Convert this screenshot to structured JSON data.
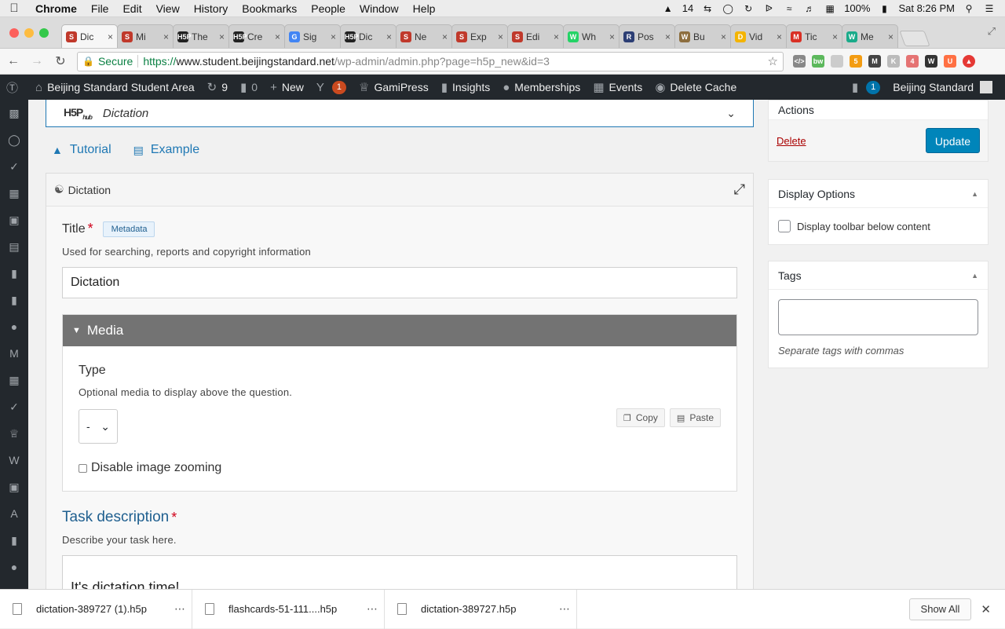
{
  "menubar": {
    "app": "Chrome",
    "items": [
      "File",
      "Edit",
      "View",
      "History",
      "Bookmarks",
      "People",
      "Window",
      "Help"
    ],
    "status": {
      "adobe_count": "14",
      "battery": "100%",
      "clock": "Sat 8:26 PM"
    }
  },
  "tabs": [
    {
      "label": "Dic",
      "favicon": "S",
      "color": "#c0392b",
      "active": true
    },
    {
      "label": "Mi",
      "favicon": "S",
      "color": "#c0392b"
    },
    {
      "label": "The",
      "favicon": "H5P",
      "color": "#222222"
    },
    {
      "label": "Cre",
      "favicon": "H5P",
      "color": "#222222"
    },
    {
      "label": "Sig",
      "favicon": "G",
      "color": "#4285f4"
    },
    {
      "label": "Dic",
      "favicon": "H5P",
      "color": "#222222"
    },
    {
      "label": "Ne",
      "favicon": "S",
      "color": "#c0392b"
    },
    {
      "label": "Exp",
      "favicon": "S",
      "color": "#c0392b"
    },
    {
      "label": "Edi",
      "favicon": "S",
      "color": "#c0392b"
    },
    {
      "label": "Wh",
      "favicon": "W",
      "color": "#25d366"
    },
    {
      "label": "Pos",
      "favicon": "R",
      "color": "#2c3e74"
    },
    {
      "label": "Bu",
      "favicon": "W",
      "color": "#8d6e3f"
    },
    {
      "label": "Vid",
      "favicon": "D",
      "color": "#f4b400"
    },
    {
      "label": "Tic",
      "favicon": "M",
      "color": "#d93025"
    },
    {
      "label": "Me",
      "favicon": "W",
      "color": "#1aab8a"
    }
  ],
  "omnibox": {
    "secure_label": "Secure",
    "scheme": "https://",
    "host": "www.student.beijingstandard.net",
    "path": "/wp-admin/admin.php?page=h5p_new&id=3"
  },
  "adminbar": {
    "site_name": "Beijing Standard Student Area",
    "updates_count": "9",
    "comments_count": "0",
    "new_label": "New",
    "yoast_count": "1",
    "gamipress": "GamiPress",
    "insights": "Insights",
    "memberships": "Memberships",
    "events": "Events",
    "delete_cache": "Delete Cache",
    "notif_count": "1",
    "user_name": "Beijing Standard"
  },
  "hub": {
    "logo": "H5P",
    "logo_sub": "hub",
    "content_type": "Dictation"
  },
  "help_links": {
    "tutorial": "Tutorial",
    "example": "Example"
  },
  "editor": {
    "header": "Dictation",
    "title_label": "Title",
    "metadata_button": "Metadata",
    "title_desc": "Used for searching, reports and copyright information",
    "title_value": "Dictation",
    "media_group": "Media",
    "type_label": "Type",
    "type_desc": "Optional media to display above the question.",
    "type_value": "-",
    "copy_label": "Copy",
    "paste_label": "Paste",
    "disable_zoom_label": "Disable image zooming",
    "task_label": "Task description",
    "task_desc": "Describe your task here.",
    "task_value": "It's dictation time!"
  },
  "sidebar": {
    "actions_title": "Actions",
    "delete_label": "Delete",
    "update_label": "Update",
    "display_options_title": "Display Options",
    "display_toolbar_label": "Display toolbar below content",
    "tags_title": "Tags",
    "tags_hint": "Separate tags with commas"
  },
  "downloads": {
    "items": [
      "dictation-389727 (1).h5p",
      "flashcards-51-111....h5p",
      "dictation-389727.h5p"
    ],
    "show_all": "Show All"
  },
  "colors": {
    "wp_dark": "#23282d",
    "wp_blue": "#0085ba",
    "h5p_blue": "#1f78b4",
    "media_header": "#737373"
  }
}
